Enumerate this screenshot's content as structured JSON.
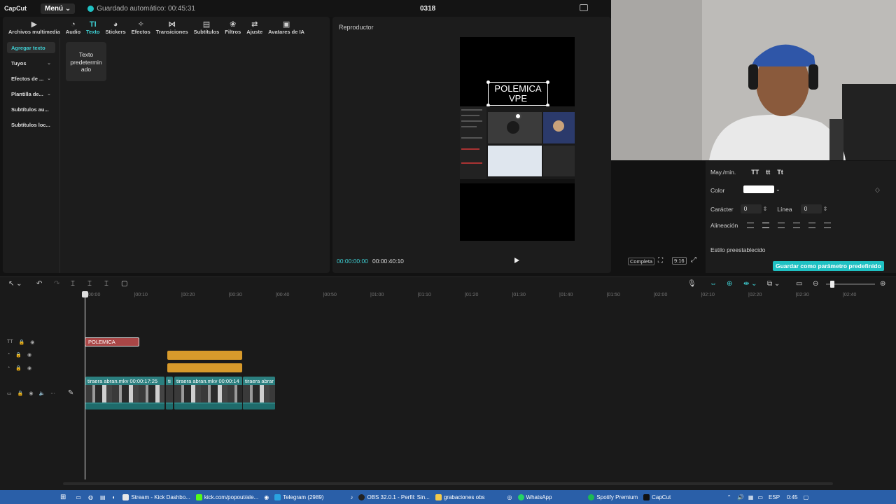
{
  "app": {
    "logo": "CapCut",
    "menu_label": "Menú",
    "autosave_text": "Guardado automático: 00:45:31",
    "project_title": "0318"
  },
  "toolbar": {
    "items": [
      {
        "icon": "▶",
        "label": "Archivos multimedia"
      },
      {
        "icon": "◔",
        "label": "Audio"
      },
      {
        "icon": "TI",
        "label": "Texto"
      },
      {
        "icon": "◕",
        "label": "Stickers"
      },
      {
        "icon": "✧",
        "label": "Efectos"
      },
      {
        "icon": "⋈",
        "label": "Transiciones"
      },
      {
        "icon": "▤",
        "label": "Subtítulos"
      },
      {
        "icon": "❀",
        "label": "Filtros"
      },
      {
        "icon": "⇄",
        "label": "Ajuste"
      },
      {
        "icon": "▣",
        "label": "Avatares de IA"
      }
    ]
  },
  "sidebar": {
    "items": [
      {
        "label": "Agregar texto"
      },
      {
        "label": "Tuyos",
        "chevron": "⌄"
      },
      {
        "label": "Efectos de ...",
        "chevron": "⌄"
      },
      {
        "label": "Plantilla de...",
        "chevron": "⌄"
      },
      {
        "label": "Subtítulos au..."
      },
      {
        "label": "Subtítulos loc..."
      }
    ]
  },
  "text_card": {
    "line1": "Texto",
    "line2": "predetermin",
    "line3": "ado"
  },
  "player": {
    "title": "Reproductor",
    "text_line1": "POLEMICA",
    "text_line2": "VPE",
    "time_current": "00:00:00:00",
    "time_total": "00:00:40:10",
    "full_label": "Completa",
    "aspect_label": "9:16"
  },
  "props": {
    "case_label": "May./min.",
    "case_options": [
      "TT",
      "tt",
      "Tt"
    ],
    "color_label": "Color",
    "char_label": "Carácter",
    "char_value": "0",
    "line_label": "Línea",
    "line_value": "0",
    "align_label": "Alineación",
    "preset_label": "Estilo preestablecido",
    "save_preset_label": "Guardar como parámetro predefinido"
  },
  "timeline": {
    "ruler_ticks": [
      "00:00",
      "00:10",
      "00:20",
      "00:30",
      "00:40",
      "00:50",
      "01:00",
      "01:10",
      "01:20",
      "01:30",
      "01:40",
      "01:50",
      "02:00",
      "02:10",
      "02:20",
      "02:30",
      "02:40"
    ],
    "text_clip": "POLEMICA",
    "video_clips": [
      {
        "label": "tiraera abran.mkv   00:00:17:25"
      },
      {
        "label": "ti"
      },
      {
        "label": "tiraera abran.mkv   00:00:14"
      },
      {
        "label": "tiraera abrar"
      }
    ]
  },
  "taskbar": {
    "items": [
      {
        "label": "Stream - Kick Dashbo...",
        "color": "#e8e8e8"
      },
      {
        "label": "kick.com/popout/ale...",
        "color": "#53fc18"
      },
      {
        "label": "Telegram (2989)",
        "color": "#2aa3e0"
      },
      {
        "label": "OBS 32.0.1 - Perfil: Sin...",
        "color": "#222222"
      },
      {
        "label": "grabaciones obs",
        "color": "#f2c94c"
      },
      {
        "label": "WhatsApp",
        "color": "#25d366"
      },
      {
        "label": "Spotify Premium",
        "color": "#1db954"
      },
      {
        "label": "CapCut",
        "color": "#111111"
      }
    ],
    "lang": "ESP",
    "clock": "0:45"
  },
  "colors": {
    "accent": "#1fc1c3",
    "text_clip": "#a94646",
    "sticker_clip": "#d89a2b",
    "video_clip": "#2b7f7f"
  }
}
